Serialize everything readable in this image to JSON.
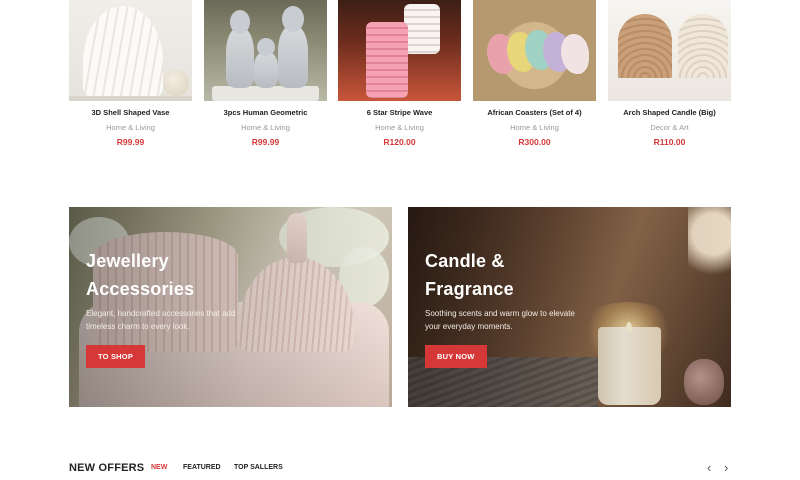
{
  "products": [
    {
      "name": "3D Shell Shaped Vase",
      "category": "Home & Living",
      "price": "R99.99",
      "image_icon": "shell-vase-image"
    },
    {
      "name": "3pcs Human Geometric",
      "category": "Home & Living",
      "price": "R99.99",
      "image_icon": "human-figures-image"
    },
    {
      "name": "6 Star Stripe Wave",
      "category": "Home & Living",
      "price": "R120.00",
      "image_icon": "wave-candle-image"
    },
    {
      "name": "African Coasters (Set of 4)",
      "category": "Home & Living",
      "price": "R300.00",
      "image_icon": "coasters-image"
    },
    {
      "name": "Arch Shaped Candle (Big)",
      "category": "Decor & Art",
      "price": "R110.00",
      "image_icon": "arch-candle-image"
    }
  ],
  "banners": [
    {
      "title": "Jewellery Accessories",
      "text": "Elegant, handcrafted accessories that add timeless charm to every look.",
      "button": "TO SHOP"
    },
    {
      "title": "Candle & Fragrance",
      "text": "Soothing scents and warm glow to elevate your everyday moments.",
      "button": "BUY NOW"
    }
  ],
  "offers": {
    "title": "NEW OFFERS",
    "tabs": [
      "NEW",
      "FEATURED",
      "TOP SALLERS"
    ],
    "active_tab": "NEW",
    "prev": "‹",
    "next": "›"
  },
  "colors": {
    "accent": "#d63838",
    "price": "#d63838",
    "muted_text": "#999999"
  }
}
